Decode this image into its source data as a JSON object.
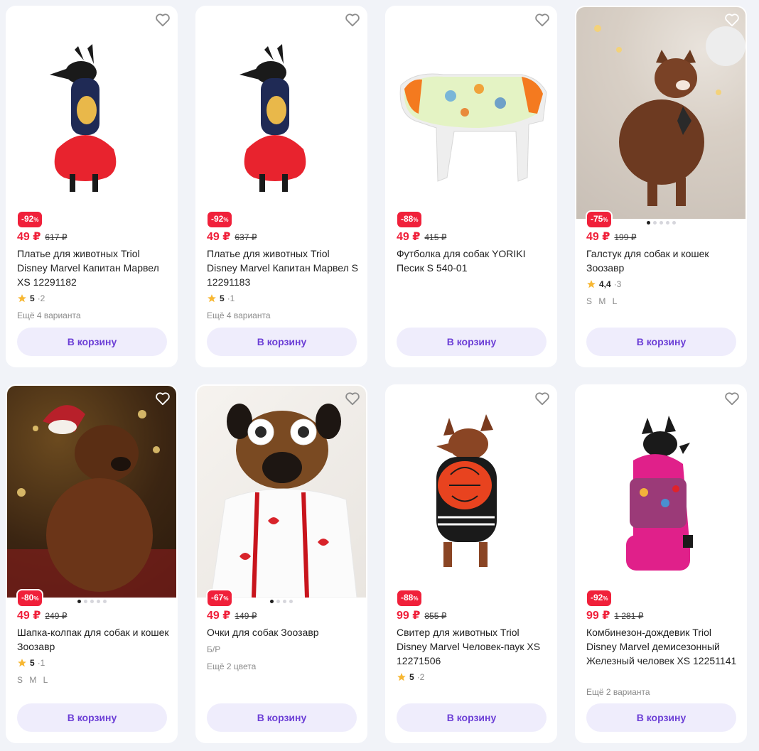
{
  "products": [
    {
      "title": "Платье для животных Triol Disney Marvel Капитан Марвел XS 12291182",
      "discount": "-92",
      "pct": "%",
      "price": "49 ₽",
      "old_price": "617 ₽",
      "rating": "5",
      "reviews": "·2",
      "extra": "Ещё 4 варианта",
      "cart": "В корзину",
      "image": "dog-in-red-tutu-dress"
    },
    {
      "title": "Платье для животных Triol Disney Marvel Капитан Марвел S 12291183",
      "discount": "-92",
      "pct": "%",
      "price": "49 ₽",
      "old_price": "637 ₽",
      "rating": "5",
      "reviews": "·1",
      "extra": "Ещё 4 варианта",
      "cart": "В корзину",
      "image": "dog-in-red-tutu-dress"
    },
    {
      "title": "Футболка для собак YORIKI Песик S 540-01",
      "discount": "-88",
      "pct": "%",
      "price": "49 ₽",
      "old_price": "415 ₽",
      "cart": "В корзину",
      "image": "dog-tshirt-on-mannequin"
    },
    {
      "title": "Галстук для собак и кошек Зоозавр",
      "discount": "-75",
      "pct": "%",
      "price": "49 ₽",
      "old_price": "199 ₽",
      "rating": "4,4",
      "reviews": "·3",
      "sizes": "S M L",
      "cart": "В корзину",
      "image": "chihuahua-with-tie"
    },
    {
      "title": "Шапка-колпак для собак и кошек Зоозавр",
      "discount": "-80",
      "pct": "%",
      "price": "49 ₽",
      "old_price": "249 ₽",
      "rating": "5",
      "reviews": "·1",
      "sizes": "S M L",
      "cart": "В корзину",
      "image": "dog-with-santa-hat"
    },
    {
      "title": "Очки для собак Зоозавр",
      "discount": "-67",
      "pct": "%",
      "price": "49 ₽",
      "old_price": "149 ₽",
      "size_label": "Б/Р",
      "extra": "Ещё 2 цвета",
      "cart": "В корзину",
      "image": "dog-with-flower-glasses"
    },
    {
      "title": "Свитер для животных Triol Disney Marvel Человек-паук XS 12271506",
      "discount": "-88",
      "pct": "%",
      "price": "99 ₽",
      "old_price": "855 ₽",
      "rating": "5",
      "reviews": "·2",
      "cart": "В корзину",
      "image": "dog-in-spiderman-sweater"
    },
    {
      "title": "Комбинезон-дождевик Triol Disney Marvel демисезонный Железный человек XS 12251141",
      "discount": "-92",
      "pct": "%",
      "price": "99 ₽",
      "old_price": "1 281 ₽",
      "extra": "Ещё 2 варианта",
      "cart": "В корзину",
      "image": "dog-in-pink-raincoat"
    }
  ],
  "colors": {
    "background": "#f1f3f8",
    "price_red": "#f0203a",
    "button_bg": "#efedfc",
    "button_text": "#6c3fd6",
    "star": "#f7b733"
  }
}
